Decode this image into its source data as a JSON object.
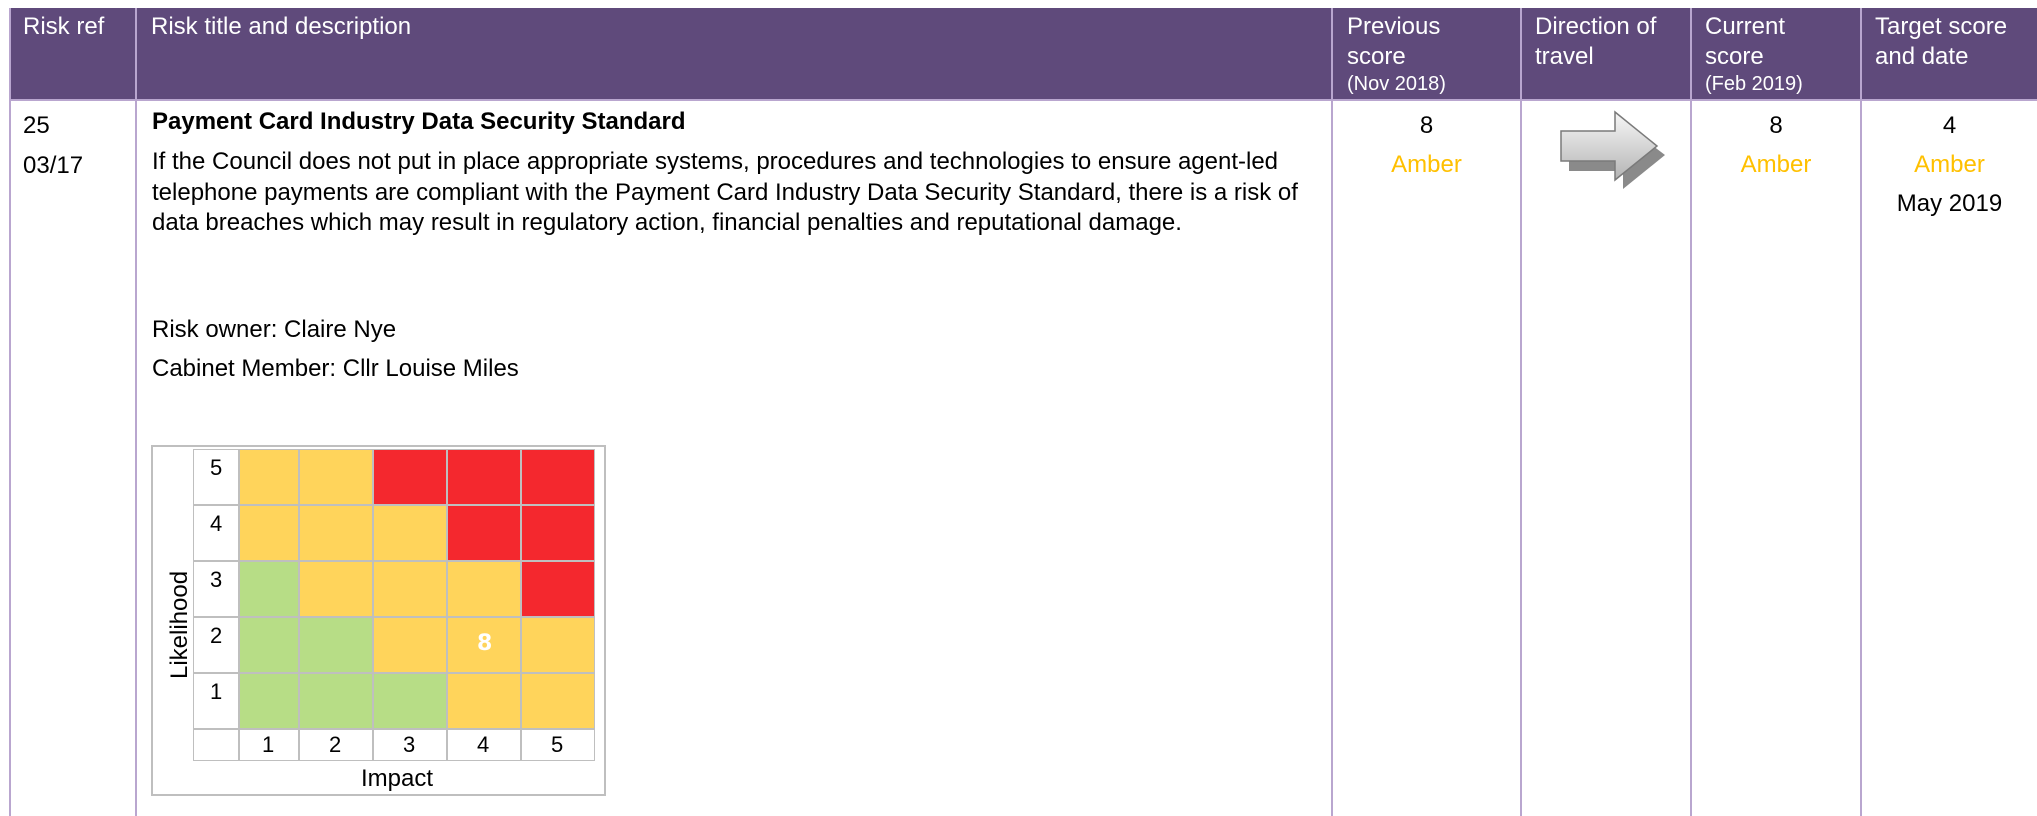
{
  "header": {
    "risk_ref": "Risk ref",
    "risk_title": "Risk title and description",
    "previous_score": "Previous score",
    "previous_score_date": "(Nov 2018)",
    "direction": "Direction of travel",
    "current_score": "Current score",
    "current_score_date": "(Feb 2019)",
    "target": "Target score and date"
  },
  "risk": {
    "ref_number": "25",
    "ref_code": "03/17",
    "title": "Payment Card Industry Data Security Standard",
    "description": "If the Council does not put in place appropriate systems, procedures and technologies to ensure agent-led telephone payments are compliant with the Payment Card Industry Data Security Standard, there is a risk of data breaches which may result in regulatory action, financial penalties and reputational damage.",
    "owner": "Risk owner: Claire Nye",
    "cabinet_member": "Cabinet Member: Cllr Louise Miles",
    "previous_score": "8",
    "previous_rating": "Amber",
    "direction_icon": "right-arrow-icon",
    "current_score": "8",
    "current_rating": "Amber",
    "target_score": "4",
    "target_rating": "Amber",
    "target_date": "May 2019"
  },
  "matrix": {
    "y_label": "Likelihood",
    "x_label": "Impact",
    "likelihood_levels": [
      "5",
      "4",
      "3",
      "2",
      "1"
    ],
    "impact_levels": [
      "1",
      "2",
      "3",
      "4",
      "5"
    ],
    "colors": {
      "green": "#b7dd86",
      "amber": "#ffd45b",
      "red": "#f4282e"
    },
    "grid": [
      [
        "amber",
        "amber",
        "red",
        "red",
        "red"
      ],
      [
        "amber",
        "amber",
        "amber",
        "red",
        "red"
      ],
      [
        "green",
        "amber",
        "amber",
        "amber",
        "red"
      ],
      [
        "green",
        "green",
        "amber",
        "amber",
        "amber"
      ],
      [
        "green",
        "green",
        "green",
        "amber",
        "amber"
      ]
    ],
    "current_marker": {
      "likelihood": 2,
      "impact": 4,
      "label": "8"
    }
  },
  "theme": {
    "header_bg": "#5f4a7b",
    "amber_text": "#ffc000",
    "rule_color": "#b9a6cf"
  }
}
